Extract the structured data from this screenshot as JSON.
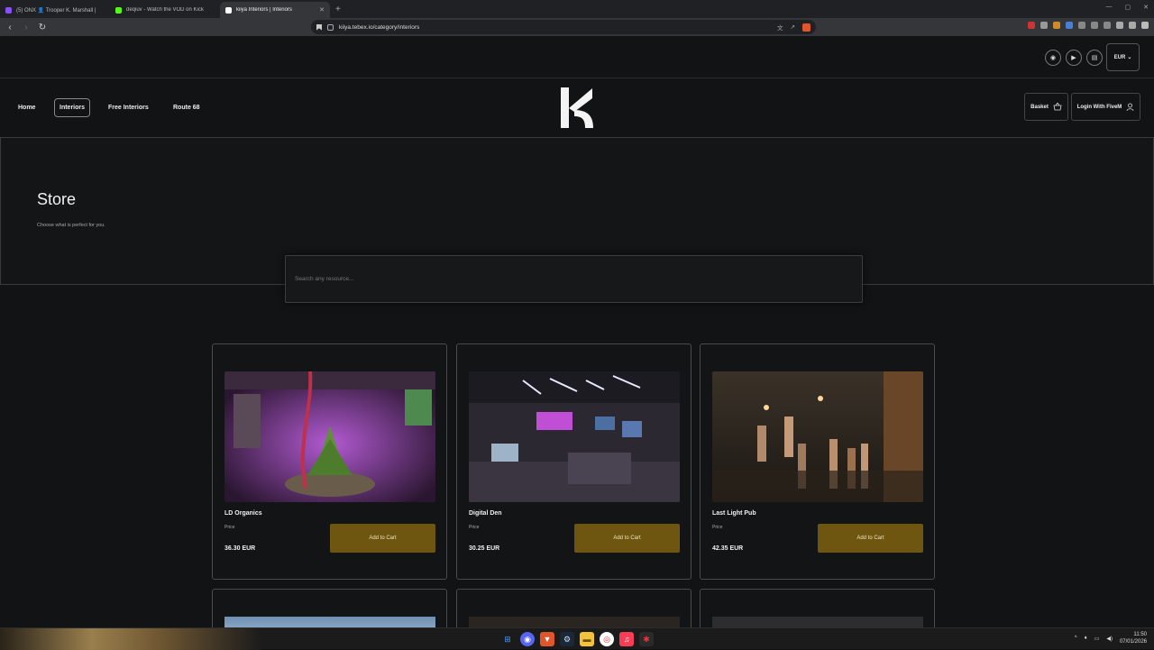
{
  "browser": {
    "tabs": [
      {
        "title": "(5) ONX  👤 Trooper K. Marshall | ",
        "color": "#8a4fff",
        "active": false
      },
      {
        "title": "deqiuv - Watch the VOD on Kick",
        "color": "#53fc18",
        "active": false
      },
      {
        "title": "kiiya Interiors | Interiors",
        "color": "#ffffff",
        "active": true
      }
    ],
    "new_tab": "+",
    "url": "kiiya.tebex.io/category/interiors"
  },
  "header": {
    "currency": "EUR",
    "icons": [
      "discord-icon",
      "youtube-icon",
      "chat-icon"
    ]
  },
  "nav": {
    "links": [
      "Home",
      "Interiors",
      "Free Interiors",
      "Route 68"
    ],
    "basket": "Basket",
    "login": "Login With FiveM"
  },
  "hero": {
    "title": "Store",
    "subtitle": "Choose what is perfect for you."
  },
  "search": {
    "placeholder": "Search any resource..."
  },
  "products": [
    {
      "name": "LD Organics",
      "price_label": "Price",
      "price": "36.30 EUR",
      "button": "Add to Cart"
    },
    {
      "name": "Digital Den",
      "price_label": "Price",
      "price": "30.25 EUR",
      "button": "Add to Cart"
    },
    {
      "name": "Last Light Pub",
      "price_label": "Price",
      "price": "42.35 EUR",
      "button": "Add to Cart"
    }
  ],
  "taskbar": {
    "time": "11:50",
    "date": "07/01/2026"
  },
  "colors": {
    "accent": "#6e5510",
    "background": "#121314"
  }
}
